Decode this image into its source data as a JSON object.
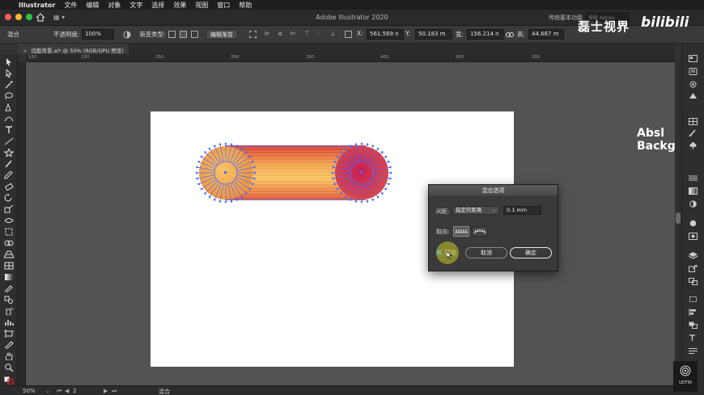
{
  "menubar": {
    "app": "Illustrator",
    "items": [
      "文件",
      "编辑",
      "对象",
      "文字",
      "选择",
      "效果",
      "视图",
      "窗口",
      "帮助"
    ]
  },
  "titlebar": {
    "title": "Adobe Illustrator 2020",
    "workspace": "传统基本功能",
    "search_placeholder": "搜索 Adobe Stock"
  },
  "control": {
    "selection_label": "混合",
    "opacity_label": "不透明度:",
    "opacity_value": "100%",
    "gradient_type_label": "渐变类型:",
    "edit_gradient_button": "编辑渐变",
    "x_label": "X:",
    "x_value": "561.569 n",
    "y_label": "Y:",
    "y_value": "50.183 m",
    "w_label": "宽:",
    "w_value": "156.214 n",
    "h_label": "高:",
    "h_value": "44.667 m"
  },
  "document": {
    "tab_label": "炫酷背景.ai* @ 50% (RGB/GPU 预览)"
  },
  "ruler": {
    "h_ticks": [
      "150",
      "200",
      "250",
      "300",
      "350",
      "400",
      "450",
      "500"
    ]
  },
  "dialog": {
    "title": "混合选项",
    "spacing_label": "间距:",
    "spacing_mode": "指定的距离",
    "spacing_value": "0.1 mm",
    "orientation_label": "取向:",
    "preview_label": "预览",
    "cancel_button": "取消",
    "ok_button": "确定"
  },
  "status": {
    "zoom": "50%",
    "page": "2",
    "tool": "混合"
  },
  "overlays": {
    "channel": "磊士视界",
    "bilibili": "bilibili",
    "promo_line1": "Absl",
    "promo_line2": "Backg",
    "watermark": "LEITIN"
  },
  "colors": {
    "blend_top": "#d63a2a",
    "blend_mid": "#f5b64a",
    "blend_bottom": "#e8532e",
    "left_circle": "#f4a948",
    "right_circle_center": "#d6245a",
    "selection_blue": "#4d6bff"
  }
}
